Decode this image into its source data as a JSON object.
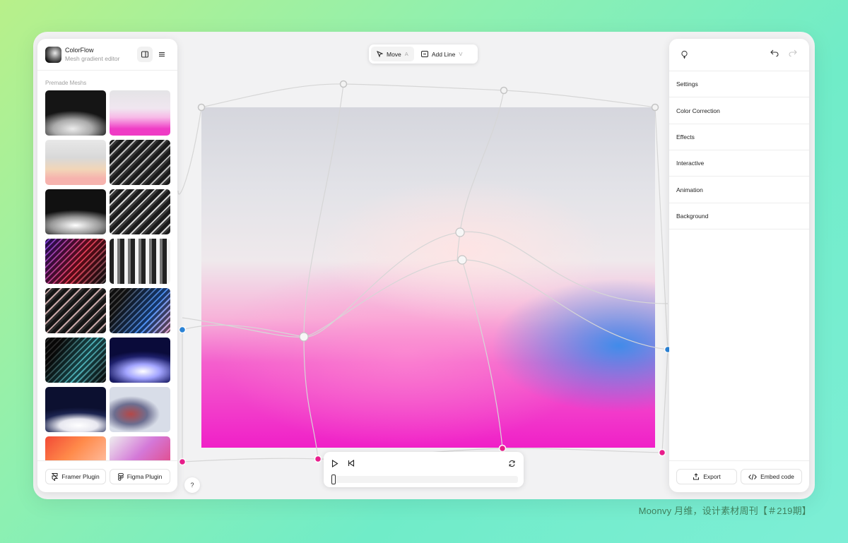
{
  "app": {
    "title": "ColorFlow",
    "subtitle": "Mesh gradient editor"
  },
  "left_panel": {
    "section_label": "Premade Meshs",
    "thumbnails": [
      "mesh-1",
      "mesh-2",
      "mesh-3",
      "mesh-4",
      "mesh-5",
      "mesh-6",
      "mesh-7",
      "mesh-8",
      "mesh-9",
      "mesh-10",
      "mesh-11",
      "mesh-12",
      "mesh-13",
      "mesh-14",
      "mesh-15",
      "mesh-16"
    ],
    "framer_plugin": "Framer Plugin",
    "figma_plugin": "Figma Plugin",
    "help": "?"
  },
  "toolbar": {
    "move_label": "Move",
    "move_key": "A",
    "add_line_label": "Add Line",
    "add_line_key": "V"
  },
  "right_panel": {
    "sections": [
      "Settings",
      "Color Correction",
      "Effects",
      "Interactive",
      "Animation",
      "Background"
    ],
    "export_label": "Export",
    "embed_label": "Embed code"
  },
  "player": {
    "progress": 0.0
  },
  "colors": {
    "accent_pink": "#e91e8c",
    "accent_blue": "#2b84d8",
    "handle_gray": "#c8c8c8"
  },
  "watermark": "Moonvy 月维，设计素材周刊【＃219期】"
}
